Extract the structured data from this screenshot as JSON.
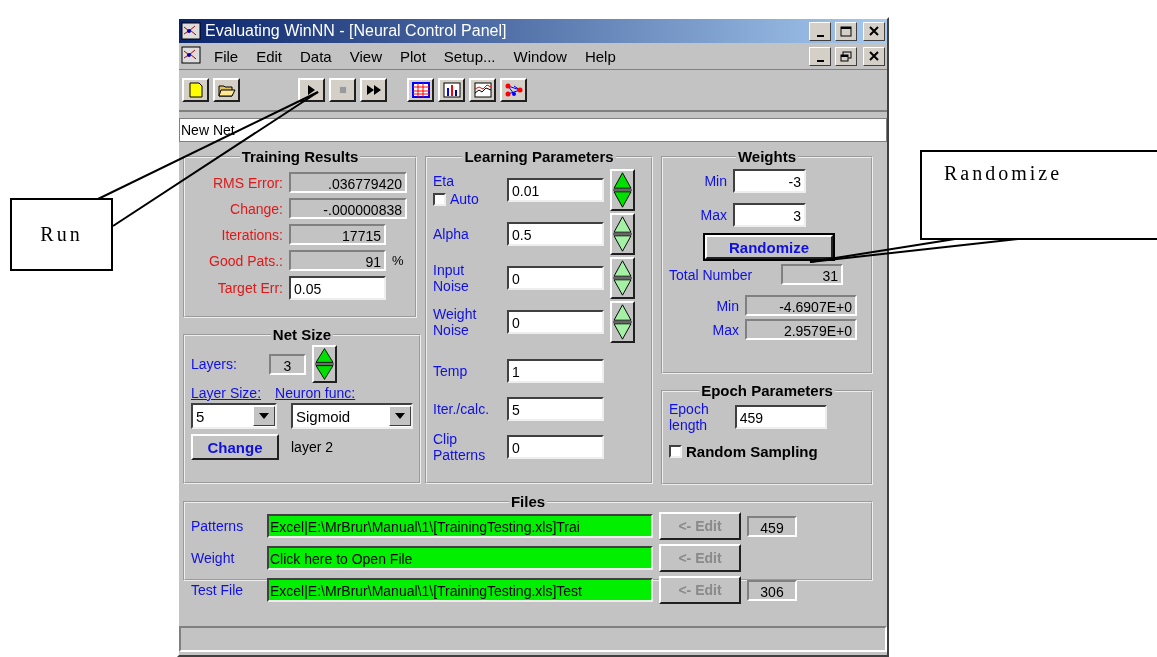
{
  "window": {
    "title": "Evaluating WinNN - [Neural Control Panel]"
  },
  "menu": [
    "File",
    "Edit",
    "Data",
    "View",
    "Plot",
    "Setup...",
    "Window",
    "Help"
  ],
  "net_name": "New Net",
  "training_results": {
    "title": "Training Results",
    "fields": [
      {
        "label": "RMS Error:",
        "value": ".036779420",
        "kind": "readonly"
      },
      {
        "label": "Change:",
        "value": "-.000000838",
        "kind": "readonly"
      },
      {
        "label": "Iterations:",
        "value": "17715",
        "kind": "readonly"
      },
      {
        "label": "Good Pats.:",
        "value": "91",
        "unit": "%",
        "kind": "readonly"
      },
      {
        "label": "Target Err:",
        "value": "0.05",
        "kind": "input"
      }
    ]
  },
  "net_size": {
    "title": "Net Size",
    "layers_label": "Layers:",
    "layers": "3",
    "spinner_disabled": false,
    "layer_size_label": "Layer Size:",
    "layer_size": "5",
    "neuron_func_label": "Neuron func:",
    "neuron_func": "Sigmoid",
    "change_button": "Change",
    "layer_note": "layer 2"
  },
  "learning_parameters": {
    "title": "Learning Parameters",
    "rows": [
      {
        "label": "Eta",
        "value": "0.01",
        "spinner_disabled": false,
        "option": {
          "label": "Auto",
          "checked": false
        }
      },
      {
        "label": "Alpha",
        "value": "0.5",
        "spinner_disabled": true
      },
      {
        "label": "Input\nNoise",
        "value": "0",
        "spinner_disabled": true
      },
      {
        "label": "Weight\nNoise",
        "value": "0",
        "spinner_disabled": true
      },
      {
        "label": "Temp",
        "value": "1"
      },
      {
        "label": "Iter./calc.",
        "value": "5"
      },
      {
        "label": "Clip\nPatterns",
        "value": "0"
      }
    ]
  },
  "weights": {
    "title": "Weights",
    "min_label": "Min",
    "min": "-3",
    "max_label": "Max",
    "max": "3",
    "randomize_button": "Randomize",
    "total_label": "Total Number",
    "total": "31",
    "result_min_label": "Min",
    "result_min": "-4.6907E+0",
    "result_max_label": "Max",
    "result_max": "2.9579E+0"
  },
  "epoch_parameters": {
    "title": "Epoch Parameters",
    "label": "Epoch\nlength",
    "value": "459",
    "option": {
      "label": "Random Sampling",
      "checked": false
    }
  },
  "files": {
    "title": "Files",
    "rows": [
      {
        "label": "Patterns",
        "path": "Excel|E:\\MrBrur\\Manual\\1\\[TrainingTesting.xls]Trai",
        "edit": "<- Edit",
        "edit_disabled": true,
        "count": "459"
      },
      {
        "label": "Weight",
        "path": "Click here to Open File",
        "edit": "<- Edit",
        "edit_disabled": true
      },
      {
        "label": "Test File",
        "path": "Excel|E:\\MrBrur\\Manual\\1\\[TrainingTesting.xls]Test",
        "edit": "<- Edit",
        "edit_disabled": true,
        "count": "306"
      }
    ]
  },
  "callouts": [
    {
      "text": "Run"
    },
    {
      "text": "Randomize"
    }
  ]
}
